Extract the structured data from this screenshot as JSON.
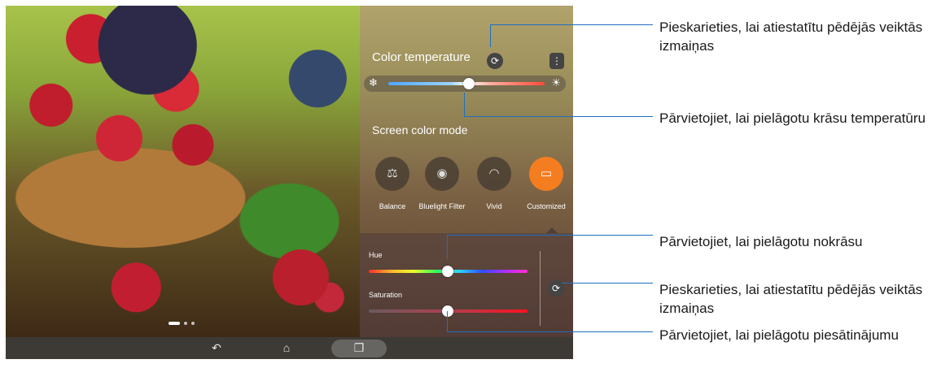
{
  "panel": {
    "color_temperature_label": "Color temperature",
    "screen_color_mode_label": "Screen color mode",
    "modes": [
      {
        "label": "Balance",
        "icon": "scale-icon",
        "active": false
      },
      {
        "label": "Bluelight Filter",
        "icon": "eye-shield-icon",
        "active": false
      },
      {
        "label": "Vivid",
        "icon": "rainbow-icon",
        "active": false
      },
      {
        "label": "Customized",
        "icon": "customize-icon",
        "active": true
      }
    ],
    "hue_label": "Hue",
    "saturation_label": "Saturation",
    "color_temperature_value": 0.5,
    "hue_value": 0.5,
    "saturation_value": 0.5
  },
  "navbar": {
    "back_icon": "back-icon",
    "home_icon": "home-icon",
    "recent_icon": "recent-apps-icon"
  },
  "callouts": [
    {
      "text": "Pieskarieties, lai atiestatītu pēdējās veiktās izmaiņas"
    },
    {
      "text": "Pārvietojiet, lai pielāgotu krāsu temperatūru"
    },
    {
      "text": "Pārvietojiet, lai pielāgotu nokrāsu"
    },
    {
      "text": "Pieskarieties, lai atiestatītu pēdējās veiktās izmaiņas"
    },
    {
      "text": "Pārvietojiet, lai pielāgotu piesātinājumu"
    }
  ],
  "colors": {
    "accent": "#f47d20",
    "callout_line": "#1f6fc0"
  }
}
